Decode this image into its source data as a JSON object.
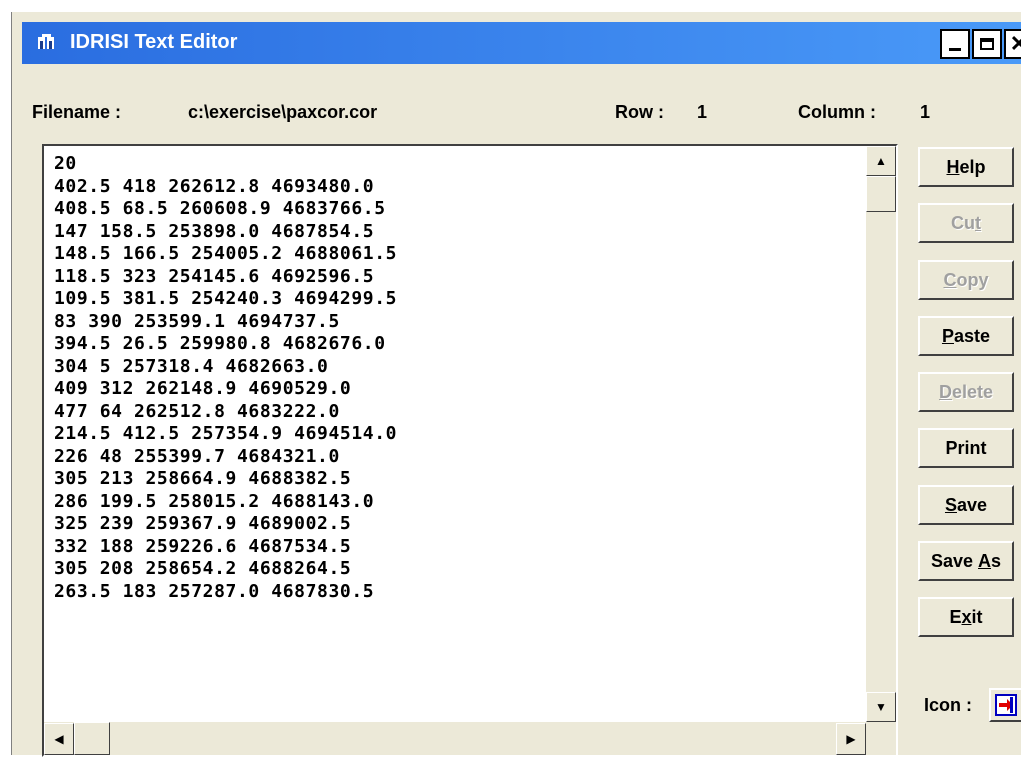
{
  "window": {
    "title": "IDRISI Text Editor",
    "controls": {
      "minimize": "",
      "maximize": "",
      "close": "✕"
    }
  },
  "info": {
    "filename_label": "Filename :",
    "filename_value": "c:\\exercise\\paxcor.cor",
    "row_label": "Row :",
    "row_value": "1",
    "column_label": "Column :",
    "column_value": "1"
  },
  "editor": {
    "lines": [
      "20",
      "402.5 418 262612.8 4693480.0",
      "408.5 68.5 260608.9 4683766.5",
      "147 158.5 253898.0 4687854.5",
      "148.5 166.5 254005.2 4688061.5",
      "118.5 323 254145.6 4692596.5",
      "109.5 381.5 254240.3 4694299.5",
      "83 390 253599.1 4694737.5",
      "394.5 26.5 259980.8 4682676.0",
      "304 5 257318.4 4682663.0",
      "409 312 262148.9 4690529.0",
      "477 64 262512.8 4683222.0",
      "214.5 412.5 257354.9 4694514.0",
      "226 48 255399.7 4684321.0",
      "305 213 258664.9 4688382.5",
      "286 199.5 258015.2 4688143.0",
      "325 239 259367.9 4689002.5",
      "332 188 259226.6 4687534.5",
      "305 208 258654.2 4688264.5",
      "263.5 183 257287.0 4687830.5"
    ]
  },
  "buttons": {
    "help": {
      "pre": "",
      "u": "H",
      "post": "elp"
    },
    "cut": {
      "pre": "Cu",
      "u": "t",
      "post": ""
    },
    "copy": {
      "pre": "",
      "u": "C",
      "post": "opy"
    },
    "paste": {
      "pre": "",
      "u": "P",
      "post": "aste"
    },
    "delete": {
      "pre": "",
      "u": "D",
      "post": "elete"
    },
    "print": {
      "pre": "Print",
      "u": "",
      "post": ""
    },
    "save": {
      "pre": "",
      "u": "S",
      "post": "ave"
    },
    "save_as": {
      "pre": "Save ",
      "u": "A",
      "post": "s"
    },
    "exit": {
      "pre": "E",
      "u": "x",
      "post": "it"
    }
  },
  "icon_label": "Icon :",
  "icons": {
    "title": "app-icon",
    "icon_button": "restore-icon",
    "scroll_up": "▲",
    "scroll_down": "▼",
    "scroll_left": "◀",
    "scroll_right": "▶"
  },
  "colors": {
    "titlebar": "#2a6de0",
    "face": "#ece9d8",
    "icon_red": "#e00000",
    "icon_blue": "#0000c0"
  }
}
